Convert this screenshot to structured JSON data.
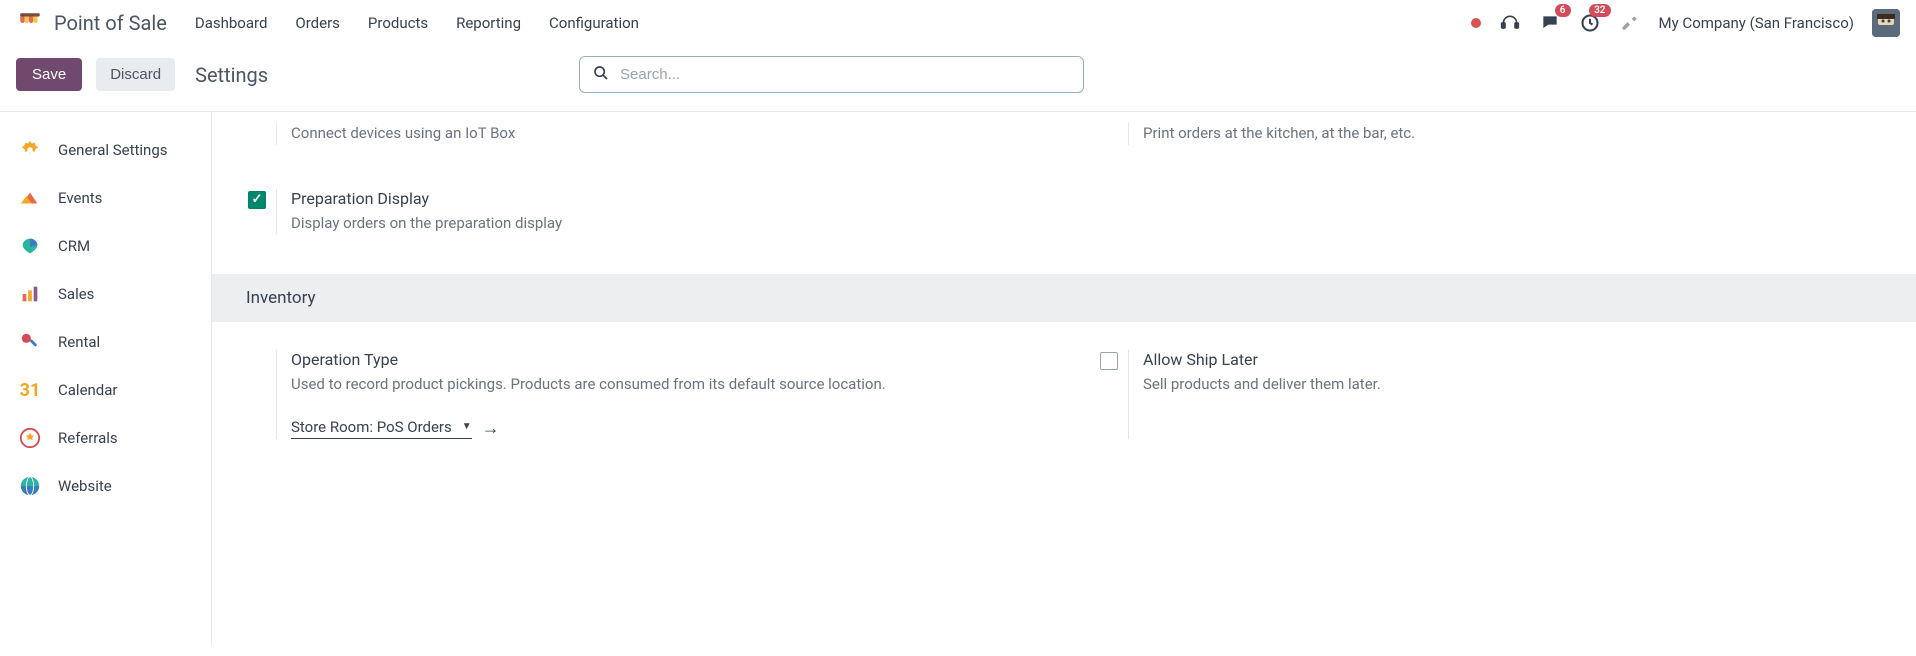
{
  "header": {
    "app_title": "Point of Sale",
    "nav": [
      "Dashboard",
      "Orders",
      "Products",
      "Reporting",
      "Configuration"
    ],
    "msg_badge": "6",
    "activity_badge": "32",
    "company": "My Company (San Francisco)"
  },
  "controls": {
    "save": "Save",
    "discard": "Discard",
    "page_title": "Settings",
    "search_placeholder": "Search..."
  },
  "sidebar": {
    "items": [
      {
        "label": "General Settings"
      },
      {
        "label": "Events"
      },
      {
        "label": "CRM"
      },
      {
        "label": "Sales"
      },
      {
        "label": "Rental"
      },
      {
        "label": "Calendar"
      },
      {
        "label": "Referrals"
      },
      {
        "label": "Website"
      }
    ]
  },
  "settings": {
    "iot_desc": "Connect devices using an IoT Box",
    "printers_desc": "Print orders at the kitchen, at the bar, etc.",
    "prep_title": "Preparation Display",
    "prep_desc": "Display orders on the preparation display",
    "section_inventory": "Inventory",
    "op_title": "Operation Type",
    "op_desc": "Used to record product pickings. Products are consumed from its default source location.",
    "op_value": "Store Room: PoS Orders",
    "ship_title": "Allow Ship Later",
    "ship_desc": "Sell products and deliver them later."
  }
}
